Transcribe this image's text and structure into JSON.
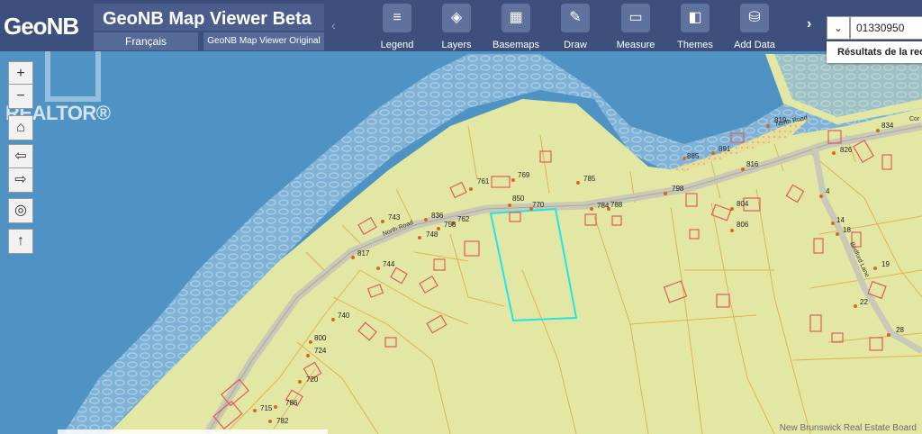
{
  "app": {
    "logo_text": "GeoNB",
    "title": "GeoNB Map Viewer Beta",
    "language_button": "Français",
    "original_button": "GeoNB Map Viewer Original"
  },
  "toolbar": {
    "tools": [
      {
        "label": "Legend",
        "icon": "list-icon",
        "glyph": "≡"
      },
      {
        "label": "Layers",
        "icon": "layers-icon",
        "glyph": "◈"
      },
      {
        "label": "Basemaps",
        "icon": "grid-icon",
        "glyph": "▦"
      },
      {
        "label": "Draw",
        "icon": "draw-icon",
        "glyph": "✎"
      },
      {
        "label": "Measure",
        "icon": "ruler-icon",
        "glyph": "▭"
      },
      {
        "label": "Themes",
        "icon": "bookmark-icon",
        "glyph": "◧"
      },
      {
        "label": "Add Data",
        "icon": "database-icon",
        "glyph": "⛁"
      }
    ]
  },
  "search": {
    "value": "01330950",
    "results_label": "Résultats de la rec"
  },
  "watermark": "REALTOR®",
  "controls": {
    "zoom_in": "+",
    "zoom_out": "−",
    "home": "⌂",
    "back": "⇦",
    "forward": "⇨",
    "locate": "◎",
    "north": "↑"
  },
  "footer": "New Brunswick Real Estate Board",
  "map": {
    "road_labels": [
      "North Road",
      "North Road",
      "Cor",
      "Bedford Lane"
    ],
    "civic_numbers": [
      "819",
      "834",
      "885",
      "891",
      "826",
      "816",
      "785",
      "769",
      "761",
      "850",
      "770",
      "784",
      "788",
      "798",
      "804",
      "4",
      "806",
      "14",
      "18",
      "836",
      "762",
      "743",
      "758",
      "748",
      "817",
      "744",
      "19",
      "22",
      "740",
      "800",
      "724",
      "28",
      "720",
      "715",
      "786",
      "782"
    ],
    "colors": {
      "water": "#4e93c3",
      "shallow": "#97c0dc",
      "land": "#e3e7a4",
      "road": "#cfcfc0",
      "lot_line": "#e0b254",
      "building": "#e05a5a",
      "selected_parcel": "#23e3e8",
      "address_dot": "#d8661c"
    }
  }
}
